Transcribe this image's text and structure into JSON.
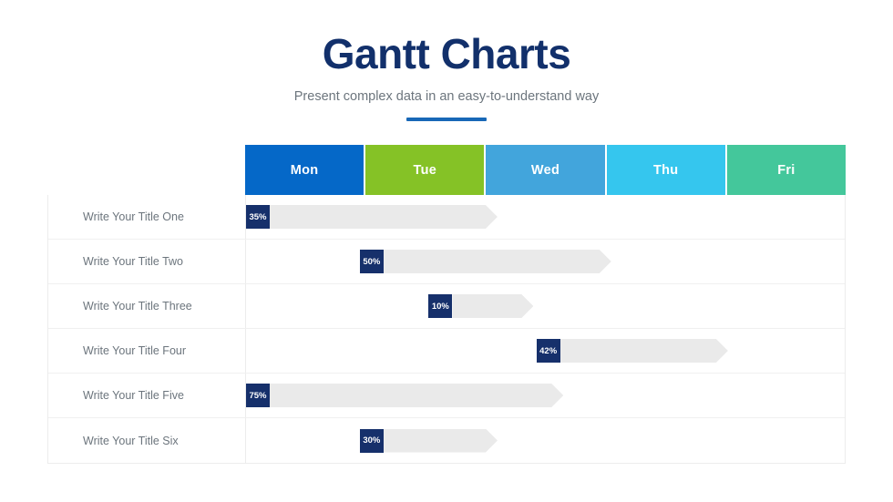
{
  "header": {
    "title": "Gantt Charts",
    "subtitle": "Present complex data in an easy-to-understand way"
  },
  "colors": {
    "title": "#12306b",
    "subtitle": "#6c757d",
    "accent_rule": "#1868b7",
    "badge": "#16306b",
    "bar": "#eaeaea"
  },
  "chart_data": {
    "type": "bar",
    "title": "Gantt Charts",
    "subtitle": "Present complex data in an easy-to-understand way",
    "xlabel": "",
    "ylabel": "",
    "grid": false,
    "legend": "none",
    "categories": [
      "Mon",
      "Tue",
      "Wed",
      "Thu",
      "Fri"
    ],
    "column_colors": [
      "#0568c8",
      "#85c226",
      "#42a5dc",
      "#35c6ee",
      "#44c79b"
    ],
    "tasks": [
      {
        "label": "Write Your Title One",
        "value": "35%",
        "start_pct": 0.0,
        "width_pct": 42.0
      },
      {
        "label": "Write Your Title Two",
        "value": "50%",
        "start_pct": 19.0,
        "width_pct": 42.0
      },
      {
        "label": "Write Your Title Three",
        "value": "10%",
        "start_pct": 30.5,
        "width_pct": 17.5
      },
      {
        "label": "Write Your Title Four",
        "value": "42%",
        "start_pct": 48.5,
        "width_pct": 32.0
      },
      {
        "label": "Write Your Title Five",
        "value": "75%",
        "start_pct": 0.0,
        "width_pct": 53.0
      },
      {
        "label": "Write Your Title Six",
        "value": "30%",
        "start_pct": 19.0,
        "width_pct": 23.0
      }
    ]
  }
}
